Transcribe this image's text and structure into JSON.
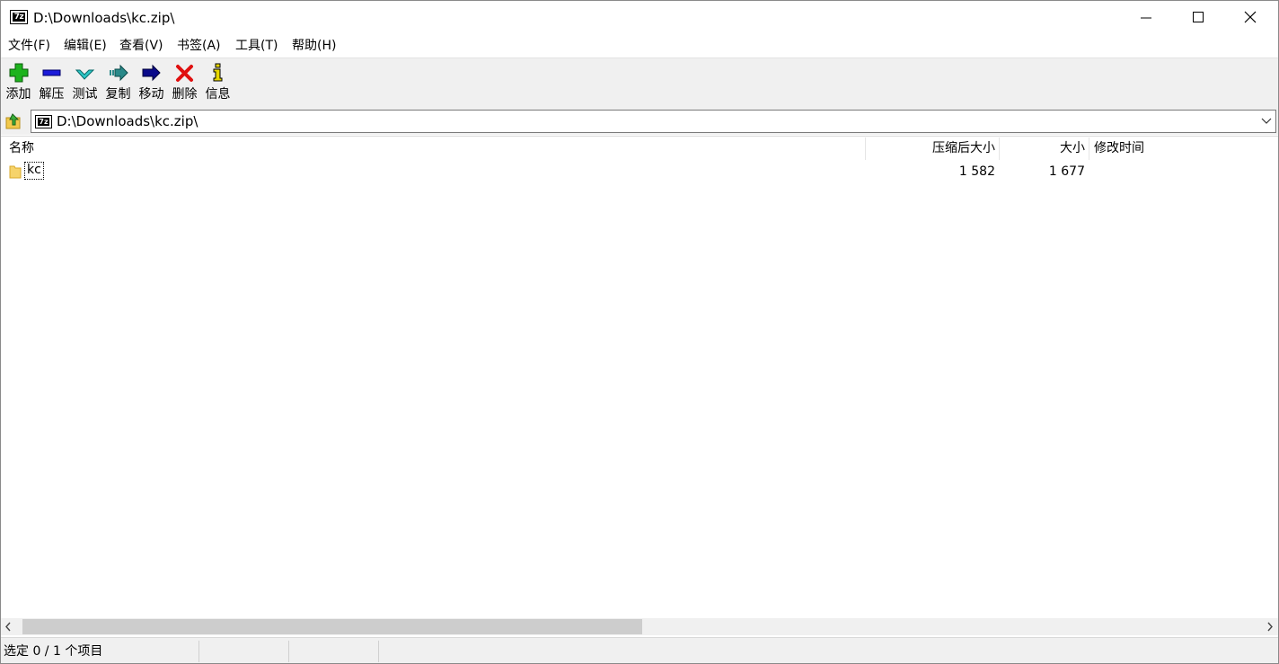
{
  "window": {
    "title": "D:\\Downloads\\kc.zip\\",
    "app_icon_text": "7z"
  },
  "menu": [
    "文件(F)",
    "编辑(E)",
    "查看(V)",
    "书签(A)",
    "工具(T)",
    "帮助(H)"
  ],
  "toolbar": [
    {
      "label": "添加",
      "icon": "add-icon",
      "color": "#1db31d"
    },
    {
      "label": "解压",
      "icon": "extract-icon",
      "color": "#1b1bd9"
    },
    {
      "label": "测试",
      "icon": "test-icon",
      "color": "#2cc7c7"
    },
    {
      "label": "复制",
      "icon": "copy-icon",
      "color": "#2a8a8a"
    },
    {
      "label": "移动",
      "icon": "move-icon",
      "color": "#0a0a8a"
    },
    {
      "label": "删除",
      "icon": "delete-icon",
      "color": "#e01010"
    },
    {
      "label": "信息",
      "icon": "info-icon",
      "color": "#e8d800"
    }
  ],
  "address": {
    "path": "D:\\Downloads\\kc.zip\\"
  },
  "columns": [
    "名称",
    "压缩后大小",
    "大小",
    "修改时间"
  ],
  "rows": [
    {
      "name": "kc",
      "packed": "1 582",
      "size": "1 677",
      "modified": "",
      "icon": "folder-icon"
    }
  ],
  "status": {
    "selection": "选定 0 / 1 个项目"
  }
}
